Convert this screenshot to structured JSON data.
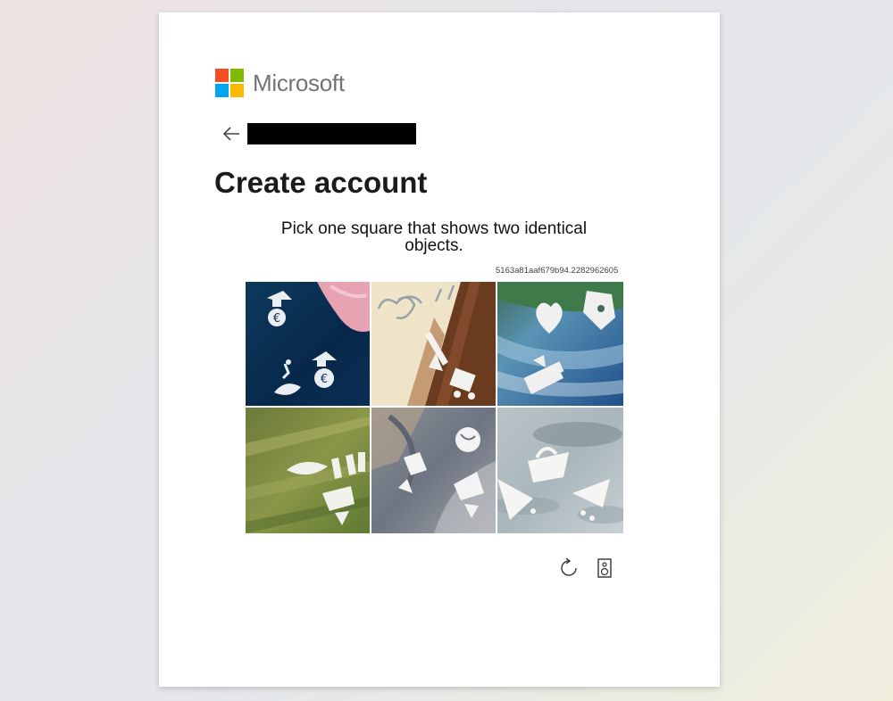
{
  "brand": {
    "name": "Microsoft",
    "logo_colors": [
      "#f25022",
      "#7fba00",
      "#00a4ef",
      "#ffb900"
    ]
  },
  "header": {
    "back_icon": "back-arrow-icon",
    "title": "Create account"
  },
  "challenge": {
    "prompt": "Pick one square that shows two identical objects.",
    "session_id": "5163a81aaf679b94.2282962605",
    "tiles": [
      {
        "index": 1
      },
      {
        "index": 2
      },
      {
        "index": 3
      },
      {
        "index": 4
      },
      {
        "index": 5
      },
      {
        "index": 6
      }
    ],
    "controls": {
      "reload_icon": "reload-icon",
      "audio_icon": "audio-speaker-icon"
    }
  }
}
